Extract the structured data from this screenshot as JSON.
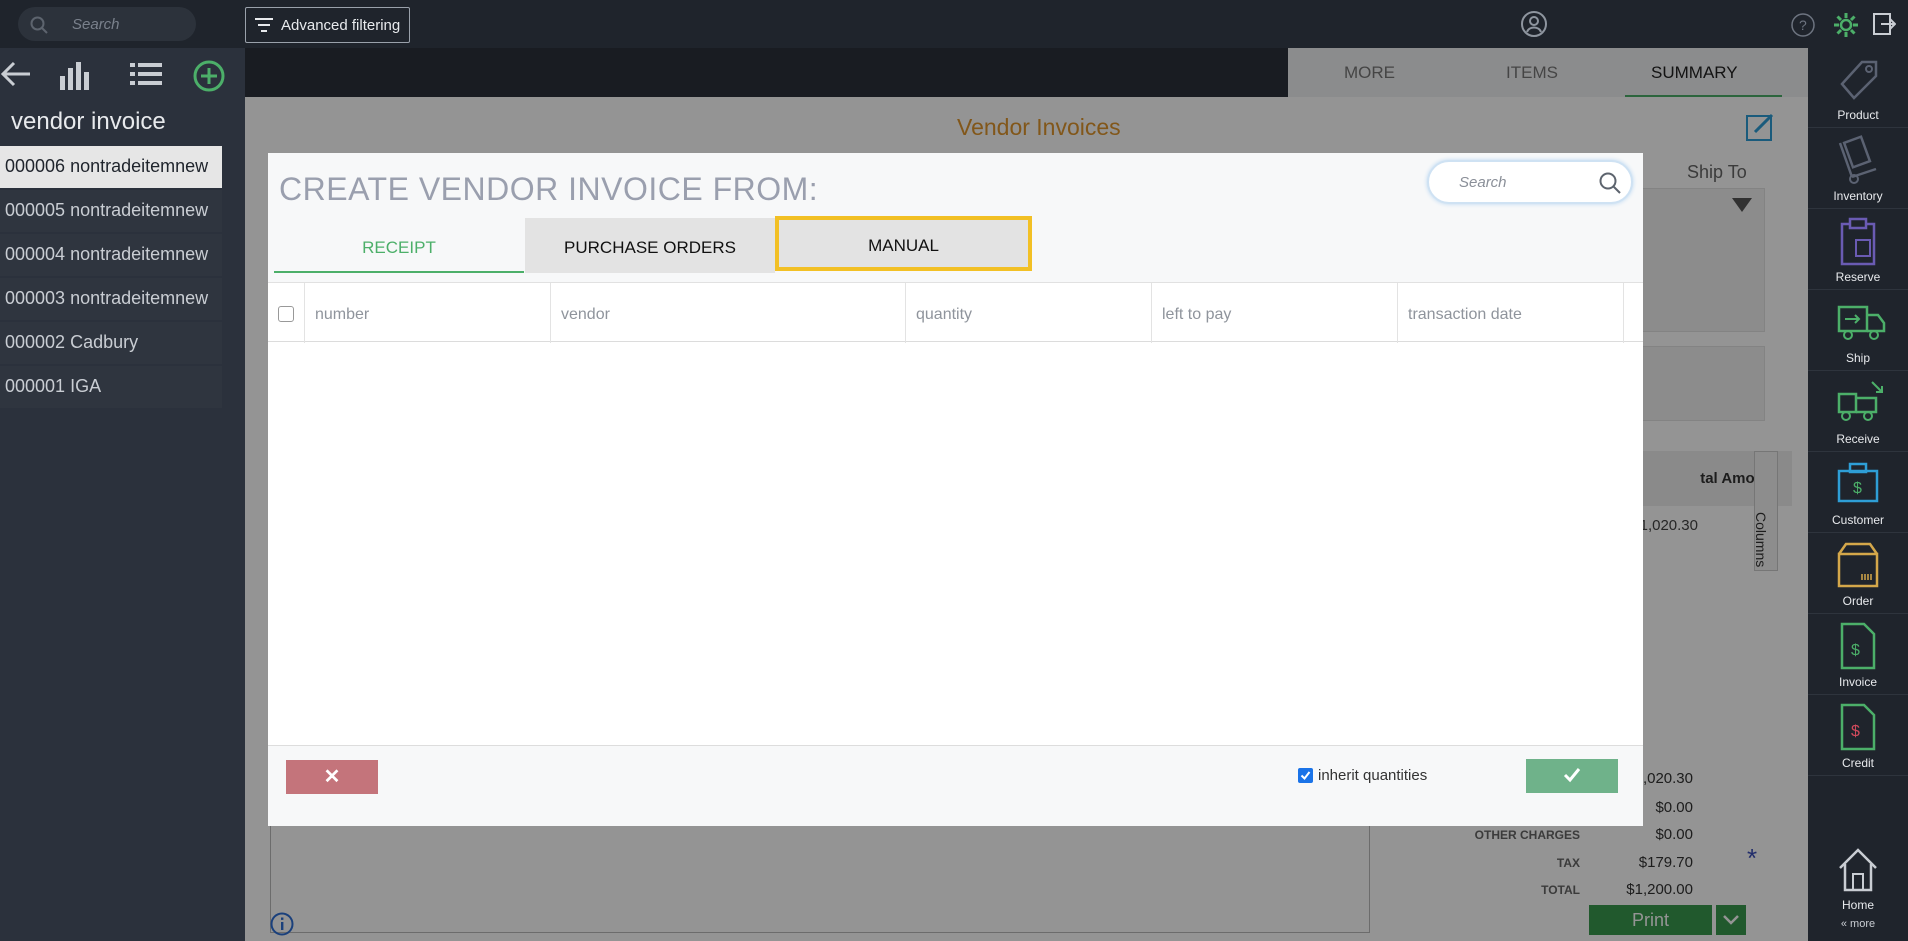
{
  "topbar": {
    "search_placeholder": "Search",
    "advanced_filtering": "Advanced filtering",
    "icons": [
      "search-icon",
      "filter-icon",
      "user-icon",
      "help-icon",
      "gear-icon",
      "logout-icon"
    ]
  },
  "left_panel": {
    "title": "vendor invoice",
    "tools": [
      "back-arrow-icon",
      "bar-chart-icon",
      "list-icon",
      "add-icon"
    ],
    "items": [
      {
        "label": "000006 nontradeitemnew",
        "selected": true
      },
      {
        "label": "000005 nontradeitemnew",
        "selected": false
      },
      {
        "label": "000004 nontradeitemnew",
        "selected": false
      },
      {
        "label": "000003 nontradeitemnew",
        "selected": false
      },
      {
        "label": "000002 Cadbury",
        "selected": false
      },
      {
        "label": "000001 IGA",
        "selected": false
      }
    ]
  },
  "main": {
    "tabs": [
      "MORE",
      "ITEMS",
      "SUMMARY"
    ],
    "active_tab": "SUMMARY",
    "title": "Vendor Invoices",
    "ship_to": "Ship To",
    "total_amount_header": "tal Amount",
    "row_total": "$1,020.30",
    "columns_label": "Columns",
    "summary": {
      "subtotal": "$1,020.30",
      "line2": "$0.00",
      "other_charges_label": "OTHER CHARGES",
      "other_charges": "$0.00",
      "tax_label": "TAX",
      "tax": "$179.70",
      "total_label": "TOTAL",
      "total": "$1,200.00"
    },
    "print": "Print"
  },
  "dock": {
    "items": [
      {
        "label": "Product",
        "icon": "tag-icon",
        "color": "#5b6272"
      },
      {
        "label": "Inventory",
        "icon": "hand-truck-icon",
        "color": "#5b6272"
      },
      {
        "label": "Reserve",
        "icon": "clipboard-icon",
        "color": "#6a5bb3"
      },
      {
        "label": "Ship",
        "icon": "truck-out-icon",
        "color": "#4caf69"
      },
      {
        "label": "Receive",
        "icon": "truck-in-icon",
        "color": "#4caf69"
      },
      {
        "label": "Customer",
        "icon": "briefcase-dollar-icon",
        "color": "#2e9ed6"
      },
      {
        "label": "Order",
        "icon": "box-icon",
        "color": "#d4a74a"
      },
      {
        "label": "Invoice",
        "icon": "invoice-dollar-icon",
        "color": "#4caf69"
      },
      {
        "label": "Credit",
        "icon": "credit-doc-icon",
        "color": "#4caf69"
      }
    ],
    "home": "Home",
    "more": "« more"
  },
  "modal": {
    "title": "CREATE VENDOR INVOICE FROM:",
    "search_placeholder": "Search",
    "tabs": [
      "RECEIPT",
      "PURCHASE ORDERS",
      "MANUAL"
    ],
    "active_tab": "RECEIPT",
    "highlighted_tab": "MANUAL",
    "columns": [
      "number",
      "vendor",
      "quantity",
      "left to pay",
      "transaction date"
    ],
    "rows": [],
    "inherit_quantities": {
      "label": "inherit quantities",
      "checked": true
    },
    "cancel_symbol": "✕",
    "ok_symbol": "✓",
    "colors": {
      "accent": "#4caf69",
      "highlight": "#f2c025",
      "cancel": "#c4747b",
      "ok": "#6fb28a"
    }
  }
}
